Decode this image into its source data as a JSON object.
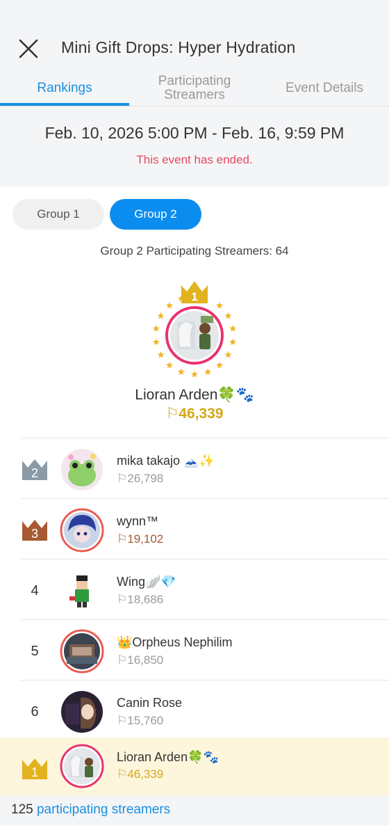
{
  "header": {
    "title": "Mini Gift Drops: Hyper Hydration"
  },
  "tabs": [
    {
      "label": "Rankings",
      "active": true
    },
    {
      "label": "Participating\nStreamers",
      "line1": "Participating",
      "line2": "Streamers",
      "active": false
    },
    {
      "label": "Event Details",
      "active": false
    }
  ],
  "event": {
    "dates": "Feb. 10, 2026 5:00 PM - Feb. 16, 9:59 PM",
    "status": "This event has ended."
  },
  "groups": {
    "buttons": [
      {
        "label": "Group 1",
        "selected": false
      },
      {
        "label": "Group 2",
        "selected": true
      }
    ],
    "count_line": "Group 2 Participating Streamers: 64"
  },
  "winner": {
    "rank": "1",
    "name": "Lioran Arden🍀🐾",
    "points": "46,339"
  },
  "rankings": [
    {
      "rank": "2",
      "name": "mika takajo 🗻✨",
      "points": "26,798",
      "crown_color": "#8a9aa6"
    },
    {
      "rank": "3",
      "name": "wynn™",
      "points": "19,102",
      "crown_color": "#a85a32"
    },
    {
      "rank": "4",
      "name": "Wing🪽💎",
      "points": "18,686"
    },
    {
      "rank": "5",
      "name": "👑Orpheus Nephilim",
      "points": "16,850"
    },
    {
      "rank": "6",
      "name": "Canin Rose",
      "points": "15,760"
    }
  ],
  "my_entry": {
    "rank": "1",
    "name": "Lioran Arden🍀🐾",
    "points": "46,339"
  },
  "footer": {
    "count": "125",
    "link": "participating streamers"
  },
  "colors": {
    "accent": "#1a8fe0",
    "gold": "#d4a81a",
    "ended_red": "#e6495f",
    "silver": "#8a9aa6",
    "bronze": "#a85a32"
  }
}
